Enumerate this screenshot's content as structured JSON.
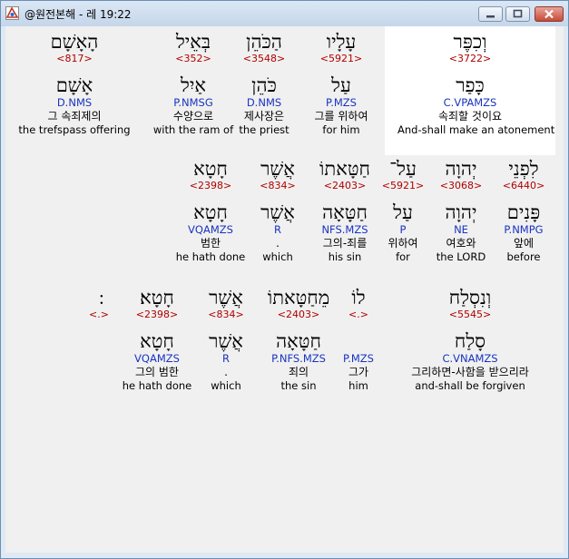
{
  "window": {
    "title": "@원전본해 - 레 19:22"
  },
  "rows": [
    [
      {
        "heb": "הָאָשָׁם",
        "num": "<817>",
        "lemma": "אָשָׁם",
        "morph": "D.NMS",
        "kor": "그 속죄제의",
        "eng": "the  trefspass offering"
      },
      {
        "heb": "בְּאֵיל",
        "num": "<352>",
        "lemma": "אַיִל",
        "morph": "P.NMSG",
        "kor": "수양으로",
        "eng": "with the ram of"
      },
      {
        "heb": "הַכֹּהֵן",
        "num": "<3548>",
        "lemma": "כֹּהֵן",
        "morph": "D.NMS",
        "kor": "제사장은",
        "eng": "the priest"
      },
      {
        "heb": "עָלָיו",
        "num": "<5921>",
        "lemma": "עַל",
        "morph": "P.MZS",
        "kor": "그를 위하여",
        "eng": "for him"
      },
      {
        "heb": "וְכִפֶּר",
        "num": "<3722>",
        "lemma": "כָּפַר",
        "morph": "C.VPAMZS",
        "kor": "속죄할 것이요",
        "eng": "And-shall make an atonement"
      }
    ],
    [
      {
        "heb": "חָטָא",
        "num": "<2398>",
        "lemma": "חָטָא",
        "morph": "VQAMZS",
        "kor": "범한",
        "eng": "he hath done"
      },
      {
        "heb": "אֲשֶׁר",
        "num": "<834>",
        "lemma": "אֲשֶׁר",
        "morph": "R",
        "kor": ".",
        "eng": "which"
      },
      {
        "heb": "חַטָּאתוֹ",
        "num": "<2403>",
        "lemma": "חַטָּאָה",
        "morph": "NFS.MZS",
        "kor": "그의-죄를",
        "eng": "his sin"
      },
      {
        "heb": "עַל־",
        "num": "<5921>",
        "lemma": "עַל",
        "morph": "P",
        "kor": "위하여",
        "eng": "for"
      },
      {
        "heb": "יְהוָה",
        "num": "<3068>",
        "lemma": "יְהוָה",
        "morph": "NE",
        "kor": "여호와",
        "eng": "the LORD"
      },
      {
        "heb": "לִפְנֵי",
        "num": "<6440>",
        "lemma": "פָּנִים",
        "morph": "P.NMPG",
        "kor": "앞에",
        "eng": "before"
      }
    ],
    [
      {
        "heb": "׃",
        "num": "<.>",
        "lemma": "",
        "morph": "",
        "kor": "",
        "eng": ""
      },
      {
        "heb": "חָטָא׃",
        "num": "<2398>",
        "lemma": "חָטָא",
        "morph": "VQAMZS",
        "kor": "그의 범한",
        "eng": "he hath done"
      },
      {
        "heb": "אֲשֶׁר",
        "num": "<834>",
        "lemma": "אֲשֶׁר",
        "morph": "R",
        "kor": ".",
        "eng": "which"
      },
      {
        "heb": "מֵחַטָּאתוֹ",
        "num": "<2403>",
        "lemma": "חַטָּאָה",
        "morph": "P.NFS.MZS",
        "kor": "죄의",
        "eng": "the sin"
      },
      {
        "heb": "לוֹ",
        "num": "<.>",
        "lemma": "",
        "morph": "P.MZS",
        "kor": "그가",
        "eng": "him"
      },
      {
        "heb": "וְנִסְלַח",
        "num": "<5545>",
        "lemma": "סָלַח",
        "morph": "C.VNAMZS",
        "kor": "그리하면-사함을 받으리라",
        "eng": "and-shall be forgiven"
      }
    ]
  ]
}
